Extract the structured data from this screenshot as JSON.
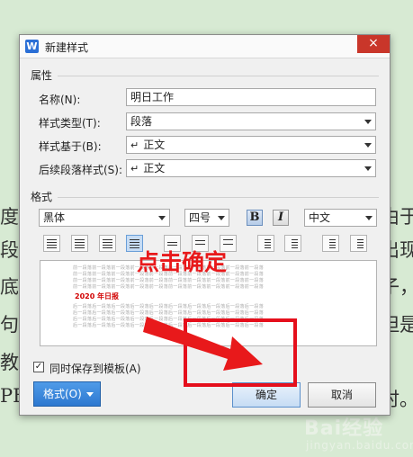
{
  "background": {
    "left_text": [
      "度",
      "段",
      "底",
      "句",
      "教",
      "PE"
    ],
    "right_text": [
      "由于",
      "出现",
      "子，",
      "但是",
      "时。"
    ]
  },
  "watermark": {
    "main": "Bai经验",
    "sub": "jingyan.baidu.com"
  },
  "dialog": {
    "app_icon": "W",
    "title": "新建样式",
    "close_icon": "×",
    "properties": {
      "heading": "属性",
      "name_label": "名称(N):",
      "name_value": "明日工作",
      "style_type_label": "样式类型(T):",
      "style_type_value": "段落",
      "based_on_label": "样式基于(B):",
      "based_on_value": "正文",
      "next_style_label": "后续段落样式(S):",
      "next_style_value": "正文",
      "para_icon": "↵"
    },
    "format": {
      "heading": "格式",
      "font": "黑体",
      "size": "四号",
      "bold": "B",
      "italic": "I",
      "script": "中文"
    },
    "preview": {
      "sample_text": "2020 年日报",
      "filler_before": "前一段落前一段落前一段落前一段落前一段落前一段落前一段落前一段落前一段落前一段落",
      "filler_after": "后一段落后一段落后一段落后一段落后一段落后一段落后一段落后一段落后一段落后一段落"
    },
    "save_to_template_label": "同时保存到模板(A)",
    "save_to_template_checked": true,
    "format_button": "格式(O)",
    "ok_button": "确定",
    "cancel_button": "取消"
  },
  "annotation": {
    "text": "点击确定",
    "color": "#e8191b"
  }
}
